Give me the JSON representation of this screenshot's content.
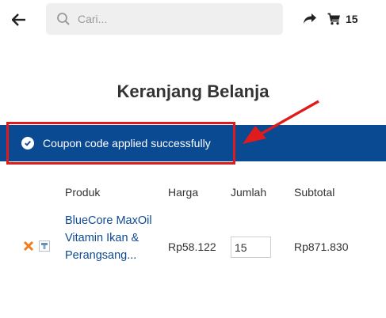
{
  "header": {
    "search": {
      "placeholder": "Cari...",
      "value": ""
    },
    "cart_count": "15"
  },
  "page_title": "Keranjang Belanja",
  "notice": {
    "message": "Coupon code applied successfully"
  },
  "table": {
    "columns": [
      "Produk",
      "Harga",
      "Jumlah",
      "Subtotal"
    ],
    "rows": [
      {
        "product": "BlueCore MaxOil Vitamin Ikan & Perangsang...",
        "price": "Rp58.122",
        "quantity": "15",
        "subtotal": "Rp871.830"
      }
    ]
  },
  "colors": {
    "notice_bg": "#094a93",
    "highlight": "#e01b1b",
    "link": "#0d4a93",
    "remove": "#f07d1a"
  }
}
